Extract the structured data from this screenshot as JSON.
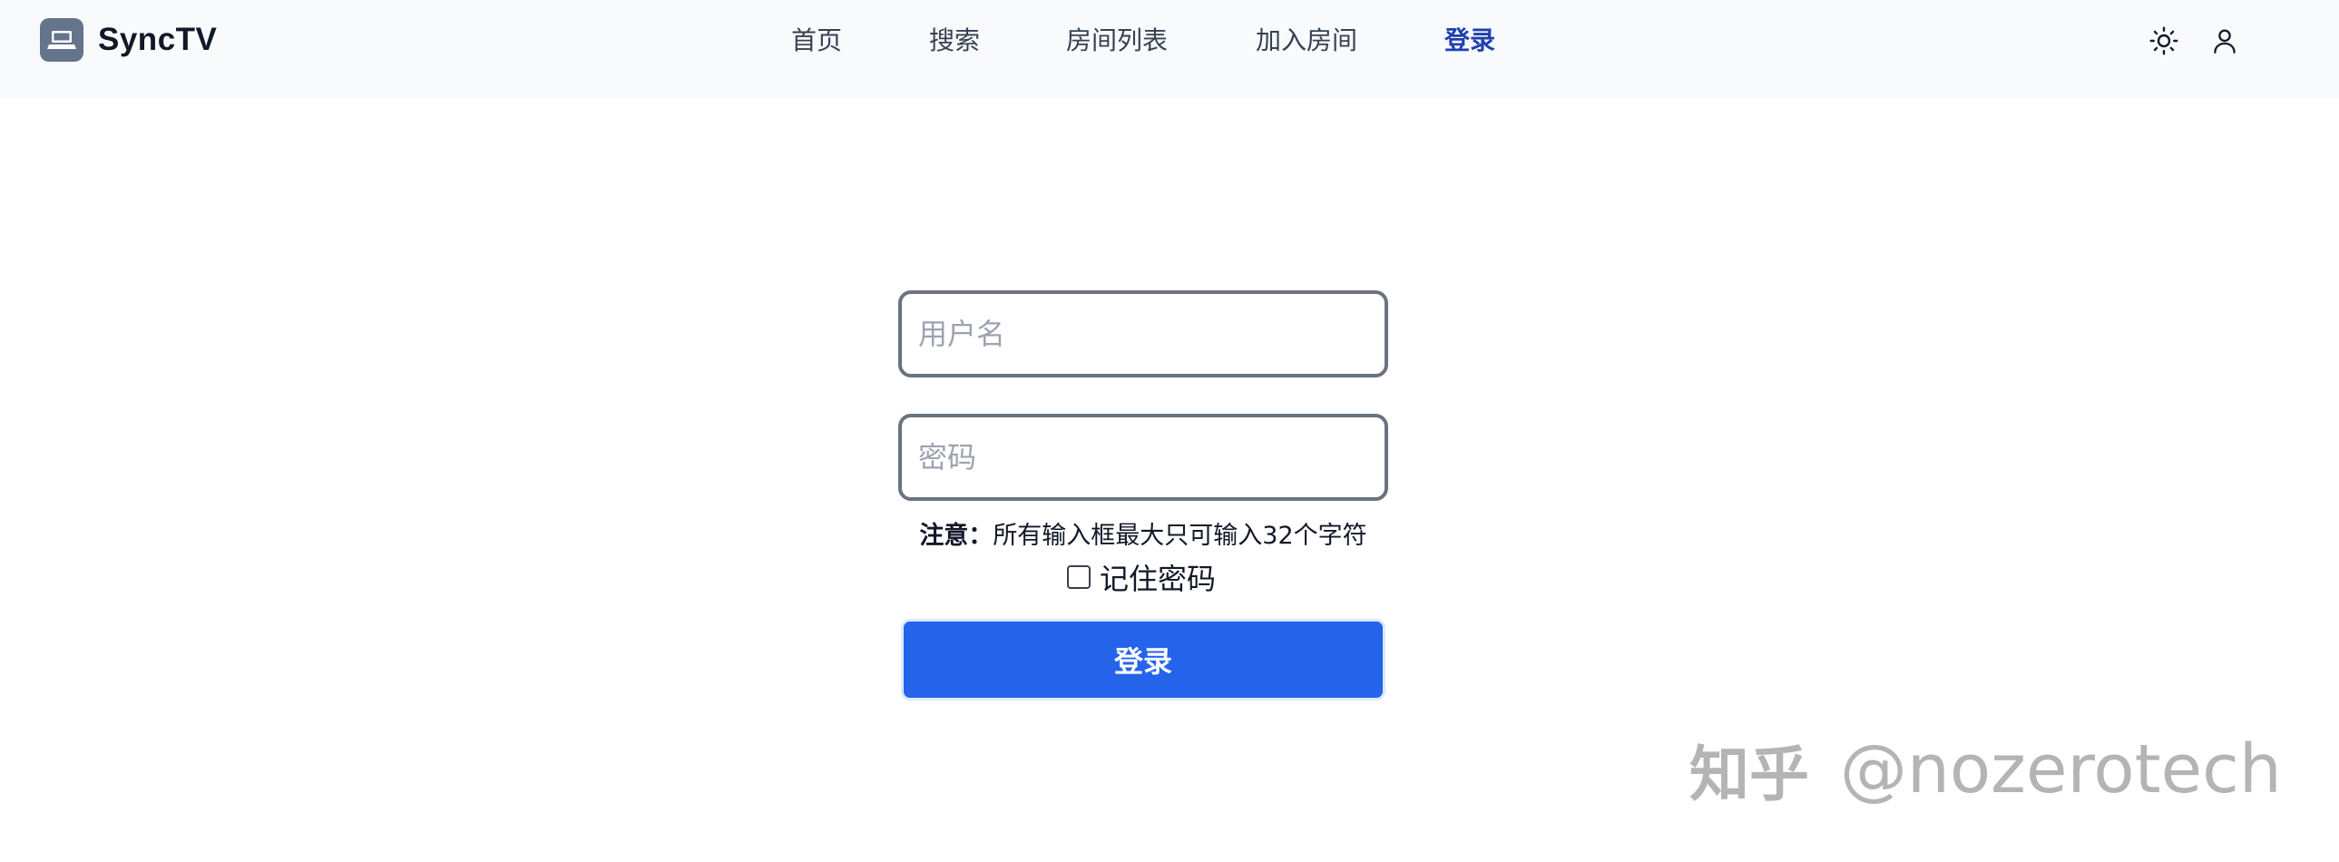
{
  "brand": {
    "name": "SyncTV",
    "logo_icon": "tv-laptop-icon",
    "logo_color": "#64748b"
  },
  "nav": {
    "items": [
      {
        "label": "首页"
      },
      {
        "label": "搜索"
      },
      {
        "label": "房间列表"
      },
      {
        "label": "加入房间"
      },
      {
        "label": "登录",
        "active": true
      }
    ],
    "active_color": "#1e40af"
  },
  "header_actions": {
    "theme_icon": "sun-icon",
    "user_icon": "user-icon"
  },
  "login_form": {
    "username_placeholder": "用户名",
    "username_value": "",
    "password_placeholder": "密码",
    "password_value": "",
    "notice_label": "注意：",
    "notice_text": "所有输入框最大只可输入32个字符",
    "remember_label": "记住密码",
    "remember_checked": false,
    "submit_label": "登录",
    "submit_color": "#2563eb"
  },
  "watermark": {
    "site": "知乎",
    "handle": "@nozerotech"
  }
}
